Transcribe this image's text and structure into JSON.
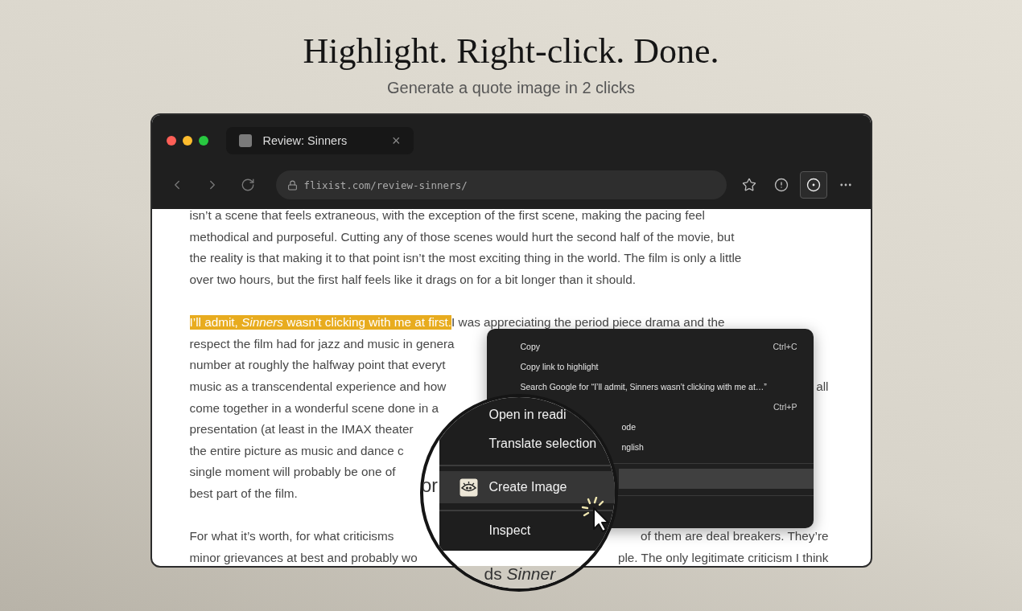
{
  "headline": "Highlight. Right-click. Done.",
  "subheadline": "Generate a quote image in 2 clicks",
  "browser": {
    "tab": {
      "title": "Review: Sinners",
      "close": "×"
    },
    "url": "flixist.com/review-sinners/",
    "extension_button": {
      "selected": true
    }
  },
  "article": {
    "paragraphs": [
      {
        "lines": [
          {
            "segments": [
              {
                "text": "isn’t a scene that feels extraneous, with the exception of the first scene, making the pacing feel",
                "highlighted": false
              }
            ]
          },
          {
            "segments": [
              {
                "text": "methodical and purposeful. Cutting any of those scenes would hurt the second half of the movie, but",
                "highlighted": false
              }
            ]
          },
          {
            "segments": [
              {
                "text": "the reality is that making it to that point isn’t the most exciting thing in the world. The film is only a little",
                "highlighted": false
              }
            ]
          },
          {
            "segments": [
              {
                "text": "over two hours, but the first half feels like it drags on for a bit longer than it should.",
                "highlighted": false
              }
            ]
          }
        ]
      },
      {
        "lines": [
          {
            "segments": [
              {
                "text": "I’ll admit, *Sinners* wasn’t clicking with me at first.",
                "highlighted": true
              },
              {
                "text": " I was appreciating the period piece drama and the",
                "highlighted": false
              }
            ]
          },
          {
            "segments": [
              {
                "text": "respect the film had for jazz and music in genera",
                "highlighted": false
              }
            ]
          },
          {
            "segments": [
              {
                "text": "number at roughly the halfway point that everyt",
                "highlighted": false
              }
            ]
          },
          {
            "segments": [
              {
                "text": "music as a transcendental experience and how",
                "highlighted": false
              }
            ],
            "tail": "all"
          },
          {
            "segments": [
              {
                "text": "come together in a wonderful scene done in a",
                "highlighted": false
              }
            ]
          },
          {
            "segments": [
              {
                "text": "presentation (at least in the IMAX theater",
                "highlighted": false
              }
            ]
          },
          {
            "segments": [
              {
                "text": "the entire picture as music and dance c",
                "highlighted": false
              }
            ]
          },
          {
            "segments": [
              {
                "text": "single moment will probably be one of",
                "highlighted": false
              }
            ]
          },
          {
            "segments": [
              {
                "text": "best part of the film.",
                "highlighted": false
              }
            ]
          }
        ]
      },
      {
        "lines": [
          {
            "segments": [
              {
                "text": "For what it’s worth, for what criticisms",
                "highlighted": false
              }
            ],
            "tail": "of them are deal breakers. They’re"
          },
          {
            "segments": [
              {
                "text": "minor grievances at best and probably wo",
                "highlighted": false
              }
            ],
            "tail": "ple. The only legitimate criticism I think"
          }
        ]
      }
    ]
  },
  "context_menu": {
    "items": [
      {
        "kind": "item",
        "label": "Copy",
        "shortcut": "Ctrl+C",
        "selected": false
      },
      {
        "kind": "item",
        "label": "Copy link to highlight",
        "selected": false
      },
      {
        "kind": "item",
        "label": "Search Google for “I’ll admit, Sinners wasn’t clicking with me at…”",
        "selected": false
      },
      {
        "kind": "cut",
        "shortcut": "Ctrl+P",
        "selected": false
      },
      {
        "kind": "cut",
        "label": "ode",
        "selected": false
      },
      {
        "kind": "cut",
        "label": "nglish",
        "selected": false
      },
      {
        "kind": "separator"
      },
      {
        "kind": "cut",
        "selected": true
      },
      {
        "kind": "separator"
      }
    ]
  },
  "magnifier": {
    "items": [
      {
        "kind": "item",
        "label": "Open in readi",
        "icon": false,
        "selected": false
      },
      {
        "kind": "item",
        "label": "Translate selection",
        "icon": false,
        "selected": false
      },
      {
        "kind": "separator"
      },
      {
        "kind": "item",
        "label": "Create Image",
        "icon": true,
        "selected": true
      },
      {
        "kind": "separator"
      },
      {
        "kind": "item",
        "label": "Inspect",
        "icon": false,
        "selected": false
      }
    ],
    "fragments": [
      {
        "kind": "page",
        "text": "or"
      },
      {
        "kind": "outside",
        "text": "ds *Sinner*"
      }
    ]
  }
}
